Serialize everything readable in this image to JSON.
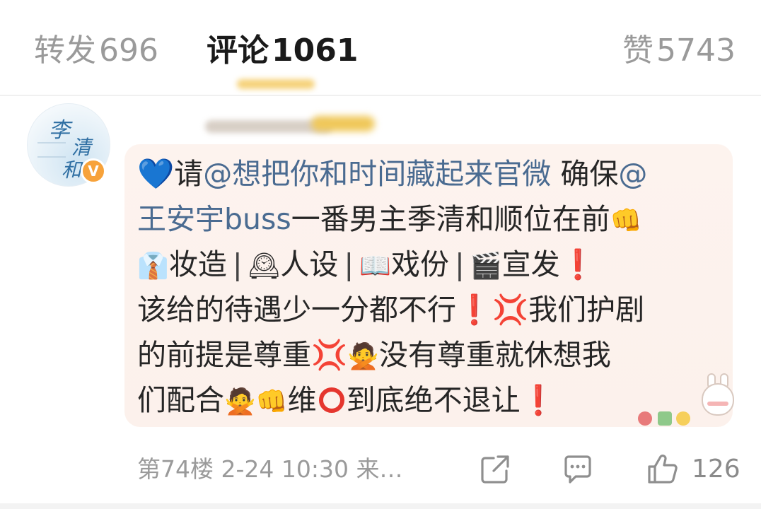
{
  "tabs": {
    "repost_label": "转发",
    "repost_count": "696",
    "comment_label": "评论",
    "comment_count": "1061",
    "like_label": "赞",
    "like_count": "5743"
  },
  "avatar": {
    "char1": "李",
    "char2": "清",
    "char3": "和",
    "badge": "V"
  },
  "comment": {
    "heart": "💙",
    "l1_a": "请",
    "l1_mention": "@想把你和时间藏起来官微",
    "l1_b": " 确保",
    "l1_at": "@",
    "l2_mention": "王安宇buss",
    "l2_b": "一番男主季清和顺位在前",
    "fist": "👊",
    "tie": "👔",
    "l3_a": "妆造",
    "clock": "🕰",
    "l3_b": "人设",
    "book": "📖",
    "l3_c": "戏份",
    "clapper": "🎬",
    "l3_d": "宣发",
    "excl": "❗",
    "l4_a": "该给的待遇少一分都不行",
    "anger": "💢",
    "l4_b": "我们护剧",
    "l5_a": "的前提是尊重",
    "person": "🙅",
    "l5_b": "没有尊重就休想我",
    "l6_a": "们配合",
    "l6_b": "维",
    "l6_c": "到底绝不退让",
    "separator": "|"
  },
  "footer": {
    "meta": "第74楼 2-24 10:30 来…",
    "like_count": "126"
  },
  "icons": [
    "share-icon",
    "comment-icon",
    "thumbs-up-icon",
    "verified-badge-icon"
  ],
  "colors": {
    "mention": "#4a6b91",
    "badge": "#f7a23a",
    "bubble": "#fdf3ee",
    "muted": "#9a9a9a"
  }
}
